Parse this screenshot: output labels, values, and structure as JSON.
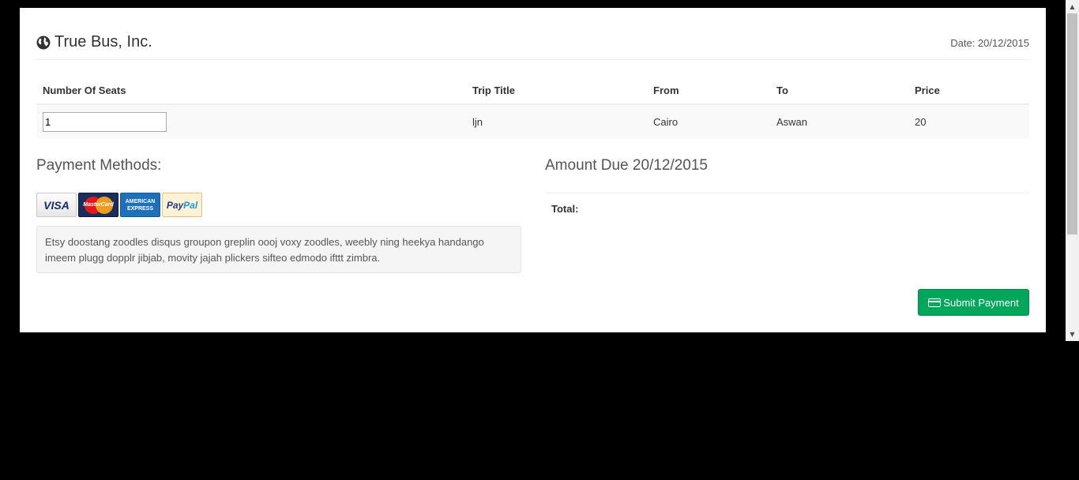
{
  "header": {
    "brand": "True Bus, Inc.",
    "date": "Date: 20/12/2015"
  },
  "table": {
    "columns": [
      "Number Of Seats",
      "Trip Title",
      "From",
      "To",
      "Price"
    ],
    "row": {
      "seats": "1",
      "trip_title": "ljn",
      "from": "Cairo",
      "to": "Aswan",
      "price": "20"
    }
  },
  "payment": {
    "title": "Payment Methods:",
    "cards": [
      "visa-icon",
      "mastercard-icon",
      "american-express-icon",
      "paypal-icon"
    ],
    "visa_text": "VISA",
    "mastercard_text": "MasterCard",
    "amex_text_1": "AMERICAN",
    "amex_text_2": "EXPRESS",
    "paypal_text_1": "Pay",
    "paypal_text_2": "Pal",
    "note": "Etsy doostang zoodles disqus groupon greplin oooj voxy zoodles, weebly ning heekya handango imeem plugg dopplr jibjab, movity jajah plickers sifteo edmodo ifttt zimbra."
  },
  "amount": {
    "title": "Amount Due 20/12/2015",
    "total_label": "Total:"
  },
  "actions": {
    "submit_label": "Submit Payment"
  },
  "colors": {
    "submit_bg": "#00a65a",
    "page_bg": "#000000",
    "panel_bg": "#ffffff"
  }
}
